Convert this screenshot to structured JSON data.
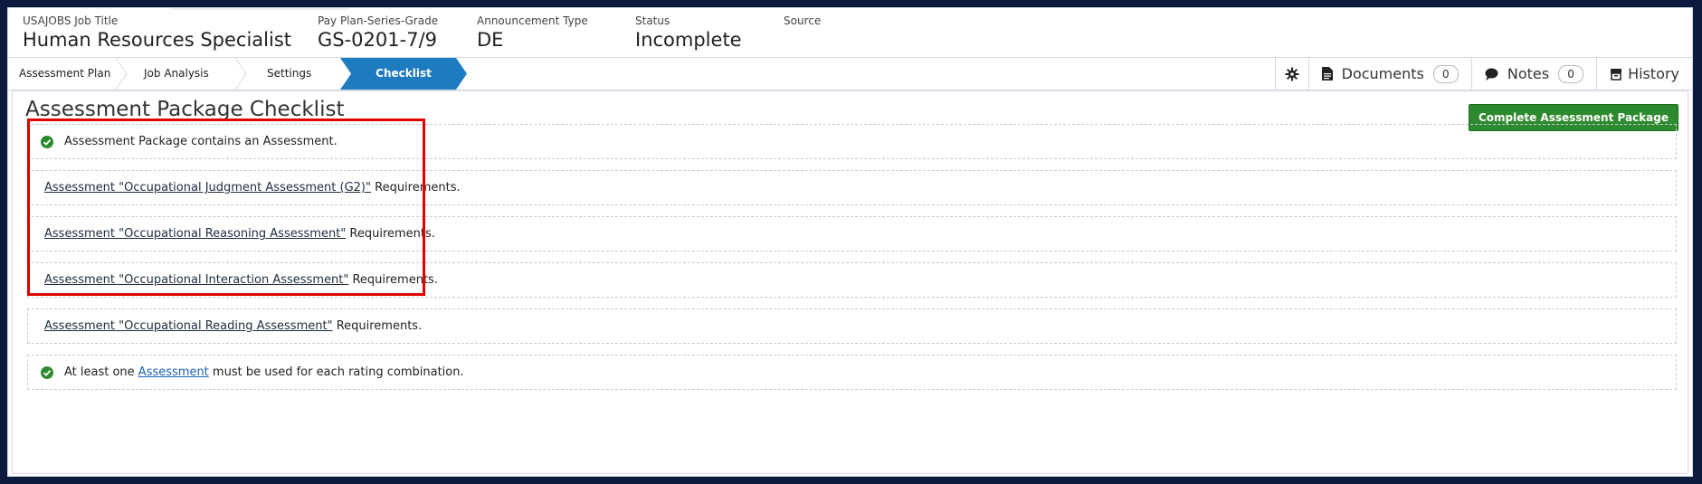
{
  "header": {
    "fields": [
      {
        "label": "USAJOBS Job Title",
        "value": "Human Resources Specialist"
      },
      {
        "label": "Pay Plan-Series-Grade",
        "value": "GS-0201-7/9"
      },
      {
        "label": "Announcement Type",
        "value": "DE"
      },
      {
        "label": "Status",
        "value": "Incomplete"
      },
      {
        "label": "Source",
        "value": ""
      }
    ]
  },
  "breadcrumb": {
    "items": [
      "Assessment Plan",
      "Job Analysis",
      "Settings",
      "Checklist"
    ],
    "active": "Checklist"
  },
  "tools": {
    "settings_icon": "gear-icon",
    "documents_label": "Documents",
    "documents_count": "0",
    "notes_label": "Notes",
    "notes_count": "0",
    "history_label": "History"
  },
  "main": {
    "title": "Assessment Package Checklist",
    "complete_button": "Complete Assessment Package",
    "items": [
      {
        "type": "check",
        "text": "Assessment Package contains an Assessment."
      },
      {
        "type": "link",
        "link": "Assessment \"Occupational Judgment Assessment (G2)\"",
        "suffix": " Requirements."
      },
      {
        "type": "link",
        "link": "Assessment \"Occupational Reasoning Assessment\"",
        "suffix": " Requirements."
      },
      {
        "type": "link",
        "link": "Assessment \"Occupational Interaction Assessment\"",
        "suffix": " Requirements."
      },
      {
        "type": "link",
        "link": "Assessment \"Occupational Reading Assessment\"",
        "suffix": " Requirements."
      },
      {
        "type": "check_link",
        "prefix": "At least one ",
        "link": "Assessment",
        "suffix": " must be used for each rating combination."
      }
    ]
  },
  "colors": {
    "accent": "#1f7bbf",
    "success": "#2e8a2e",
    "highlight": "#e00000"
  }
}
